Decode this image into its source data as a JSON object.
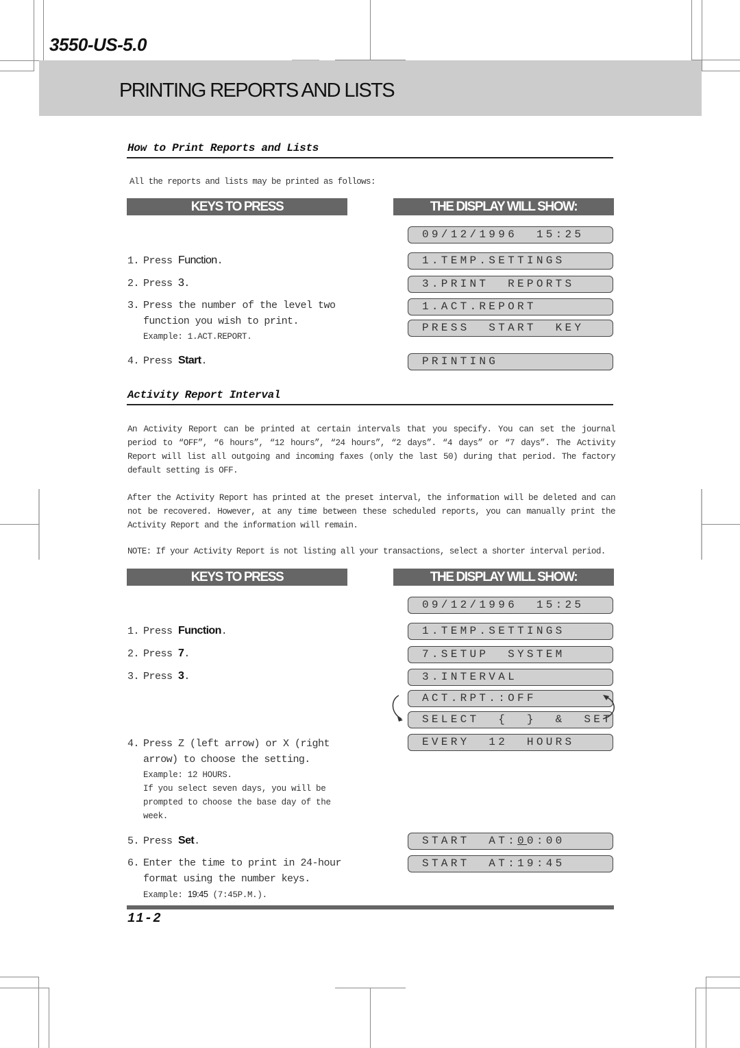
{
  "header": {
    "model": "3550-US-5.0",
    "chapter_title": "PRINTING REPORTS AND LISTS"
  },
  "section1": {
    "title": "How to Print Reports and Lists",
    "intro": "All the reports and lists may be printed as follows:",
    "keys_header": "KEYS TO PRESS",
    "display_header": "THE DISPLAY WILL SHOW:",
    "steps": [
      {
        "num": "1.",
        "text": "Press ",
        "key": "Function",
        "end": "."
      },
      {
        "num": "2.",
        "text": "Press ",
        "key": "3",
        "end": "."
      },
      {
        "num": "3.",
        "text": "Press the number of the level two",
        "line2": "function you wish to print.",
        "example": "Example: 1.ACT.REPORT."
      },
      {
        "num": "4.",
        "text": "Press ",
        "key": "Start",
        "end": "."
      }
    ],
    "displays": [
      "09/12/1996  15:25",
      "1.TEMP.SETTINGS",
      "3.PRINT  REPORTS",
      "1.ACT.REPORT",
      "PRESS  START  KEY",
      "PRINTING"
    ]
  },
  "section2": {
    "title": "Activity Report Interval",
    "paragraph1": "An Activity Report can be printed at certain intervals that you specify. You can set the journal period to “OFF”, “6 hours”, “12 hours”, “24 hours”, “2 days”. “4 days” or “7 days”. The Activity Report will list all outgoing and incoming faxes (only the last 50) during that period. The factory default setting is OFF.",
    "paragraph2": "After the Activity Report has printed at the preset interval, the information will be deleted and can not be recovered. However, at any time between these scheduled reports, you can manually print the Activity Report and the information will remain.",
    "note": "NOTE: If your Activity Report is not listing all your transactions, select a shorter interval period.",
    "keys_header": "KEYS TO PRESS",
    "display_header": "THE DISPLAY WILL SHOW:",
    "steps": [
      {
        "num": "1.",
        "text": "Press ",
        "key": "Function",
        "end": "."
      },
      {
        "num": "2.",
        "text": "Press ",
        "key": "7",
        "end": "."
      },
      {
        "num": "3.",
        "text": "Press ",
        "key": "3",
        "end": "."
      },
      {
        "num": "4.",
        "text": "Press Z (left arrow) or X (right",
        "line2": "arrow) to choose the setting.",
        "example": "Example: 12 HOURS.",
        "extra": [
          "If you select seven days, you will be",
          "prompted to choose the base day of the",
          "week."
        ]
      },
      {
        "num": "5.",
        "text": "Press ",
        "key": "Set",
        "end": "."
      },
      {
        "num": "6.",
        "text": "Enter the time to print in 24-hour",
        "line2": "format using the number keys.",
        "example_prefix": "Example: ",
        "example_key": "19:45",
        "example_suffix": " (7:45P.M.)."
      }
    ],
    "displays": [
      "09/12/1996  15:25",
      "1.TEMP.SETTINGS",
      "7.SETUP  SYSTEM",
      "3.INTERVAL",
      "ACT.RPT.:OFF",
      "SELECT  {  }  &  SET",
      "EVERY  12  HOURS",
      {
        "pre": "START  AT:",
        "cursor": "0",
        "post": "0:00"
      },
      "START  AT:19:45"
    ]
  },
  "footer": {
    "page_number": "11-2"
  }
}
